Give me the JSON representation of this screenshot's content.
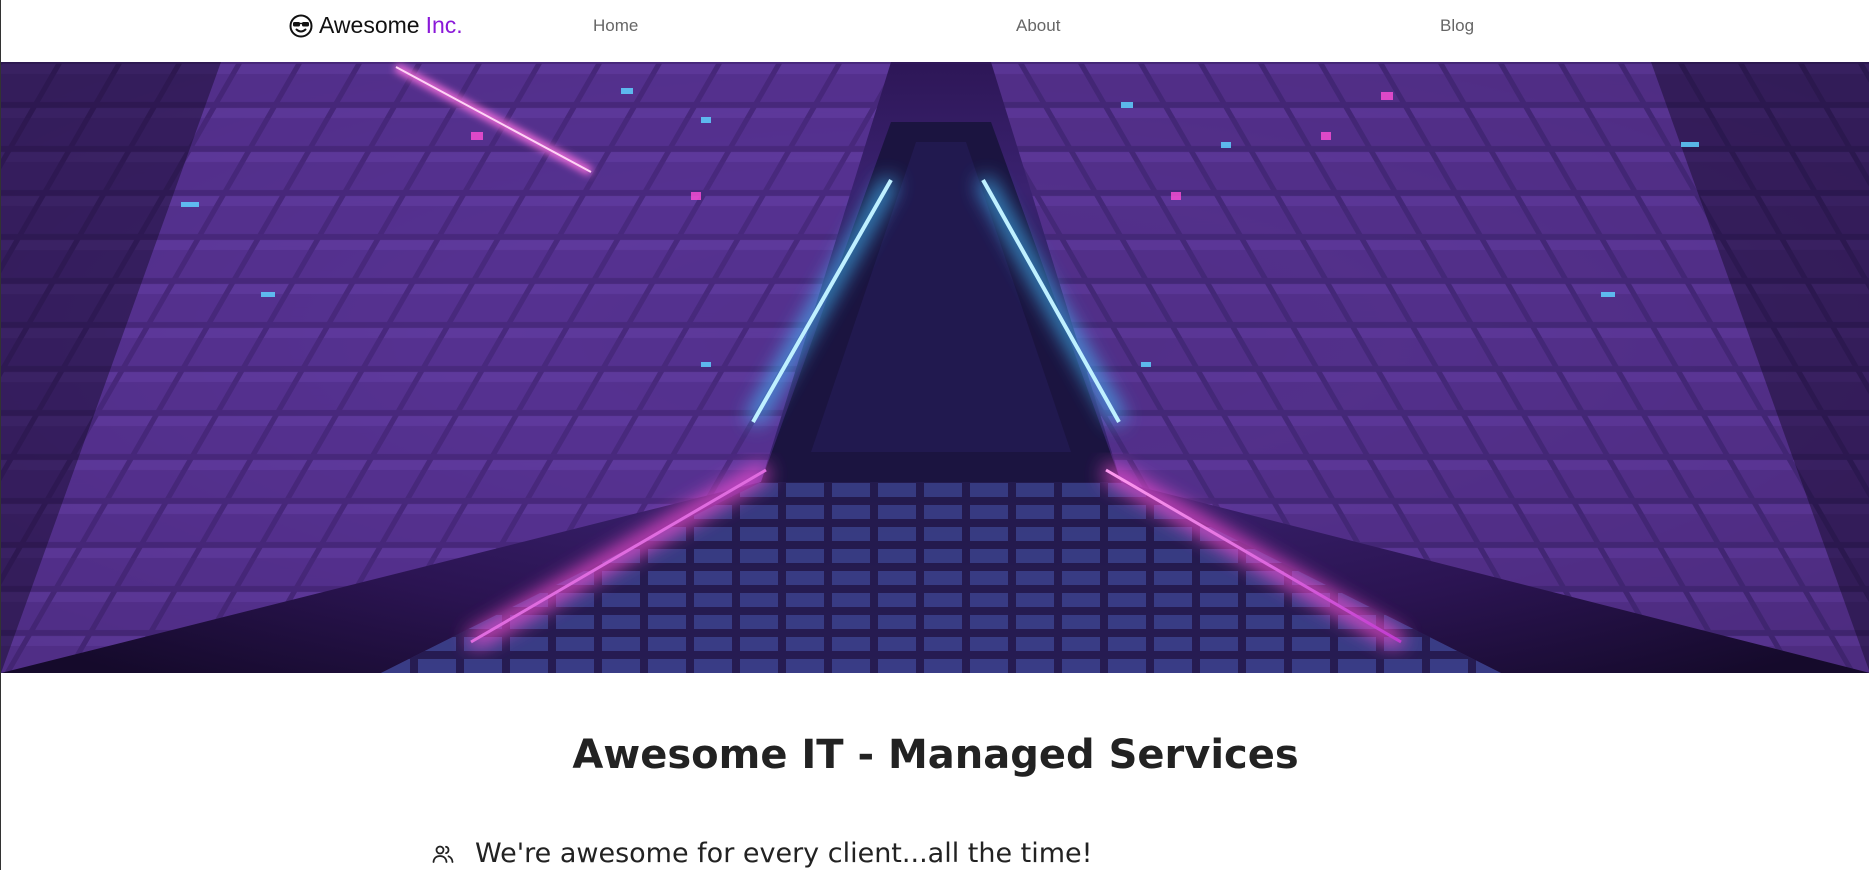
{
  "navbar": {
    "brand": {
      "name": "Awesome",
      "accent": "Inc.",
      "icon": "sunglasses-face-icon"
    },
    "links": [
      {
        "label": "Home"
      },
      {
        "label": "About"
      },
      {
        "label": "Blog"
      }
    ]
  },
  "hero": {
    "image": "neon-triangle-tunnel-image",
    "colors": {
      "background": "#1b0f35",
      "neon_blue": "#5fd0ff",
      "neon_pink": "#ff4fd8",
      "panel_purple": "#5a2f8f"
    }
  },
  "main": {
    "title": "Awesome IT - Managed Services",
    "features": [
      {
        "icon": "users-icon",
        "text": "We're awesome for every client...all the time!"
      }
    ]
  },
  "colors": {
    "accent": "#8a18d8",
    "text": "#222222",
    "nav_link": "#666666"
  }
}
